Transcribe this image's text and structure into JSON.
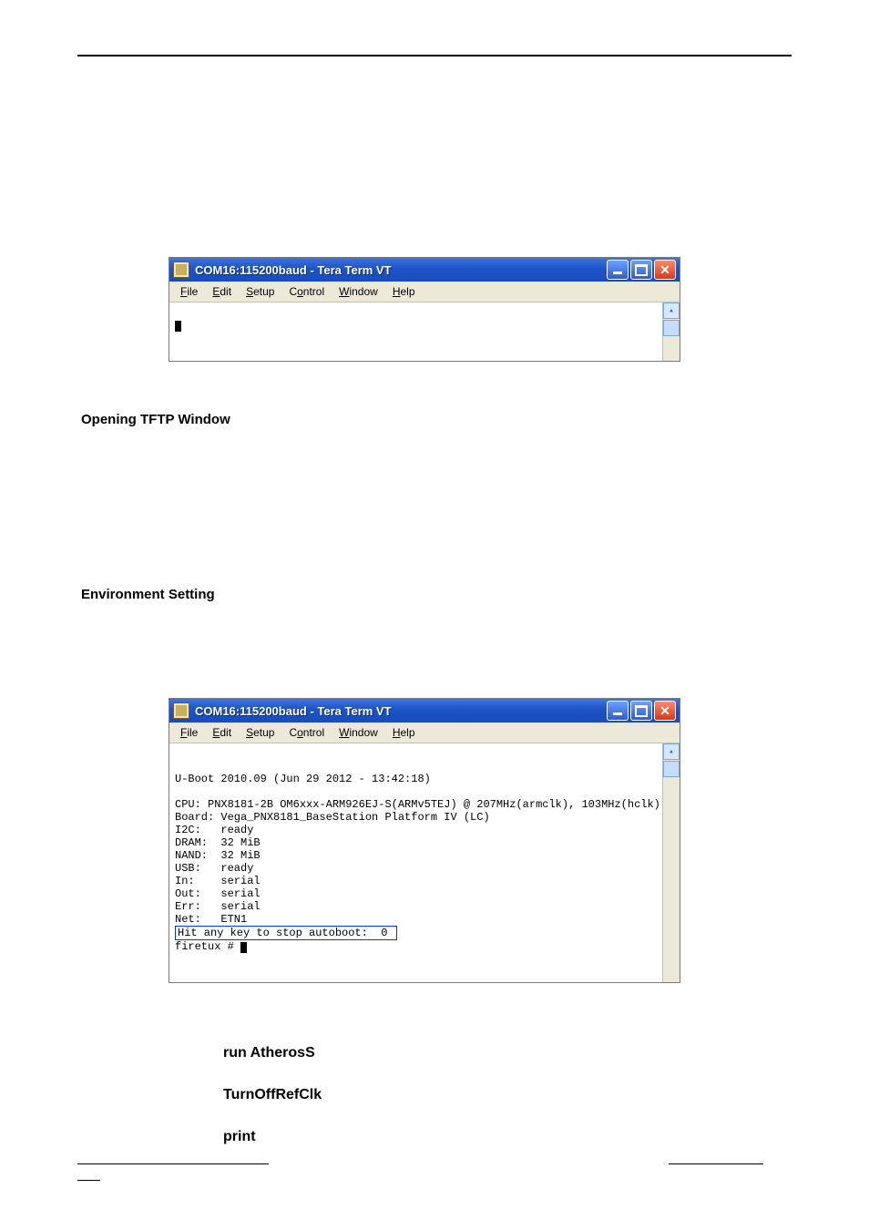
{
  "headings": {
    "tftp": "Opening TFTP Window",
    "env": "Environment Setting"
  },
  "commands": {
    "c1": "run AtherosS",
    "c2": "TurnOffRefClk",
    "c3": "print"
  },
  "menus": {
    "file": "File",
    "edit": "Edit",
    "setup": "Setup",
    "control": "Control",
    "window": "Window",
    "help": "Help"
  },
  "win1": {
    "title": "COM16:115200baud - Tera Term VT"
  },
  "win2": {
    "title": "COM16:115200baud - Tera Term VT",
    "lines": {
      "l0": "",
      "l1": "U-Boot 2010.09 (Jun 29 2012 - 13:42:18)",
      "l2": "",
      "l3": "CPU: PNX8181-2B OM6xxx-ARM926EJ-S(ARMv5TEJ) @ 207MHz(armclk), 103MHz(hclk)",
      "l4": "Board: Vega_PNX8181_BaseStation Platform IV (LC)",
      "l5": "I2C:   ready",
      "l6": "DRAM:  32 MiB",
      "l7": "NAND:  32 MiB",
      "l8": "USB:   ready",
      "l9": "In:    serial",
      "l10": "Out:   serial",
      "l11": "Err:   serial",
      "l12": "Net:   ETN1",
      "l13": "Hit any key to stop autoboot:  0 ",
      "l14": "firetux # "
    }
  },
  "icons": {
    "minimize": "minimize-icon",
    "maximize": "maximize-icon",
    "close": "close-icon",
    "scroll_up": "scroll-up-icon",
    "app": "app-icon"
  }
}
